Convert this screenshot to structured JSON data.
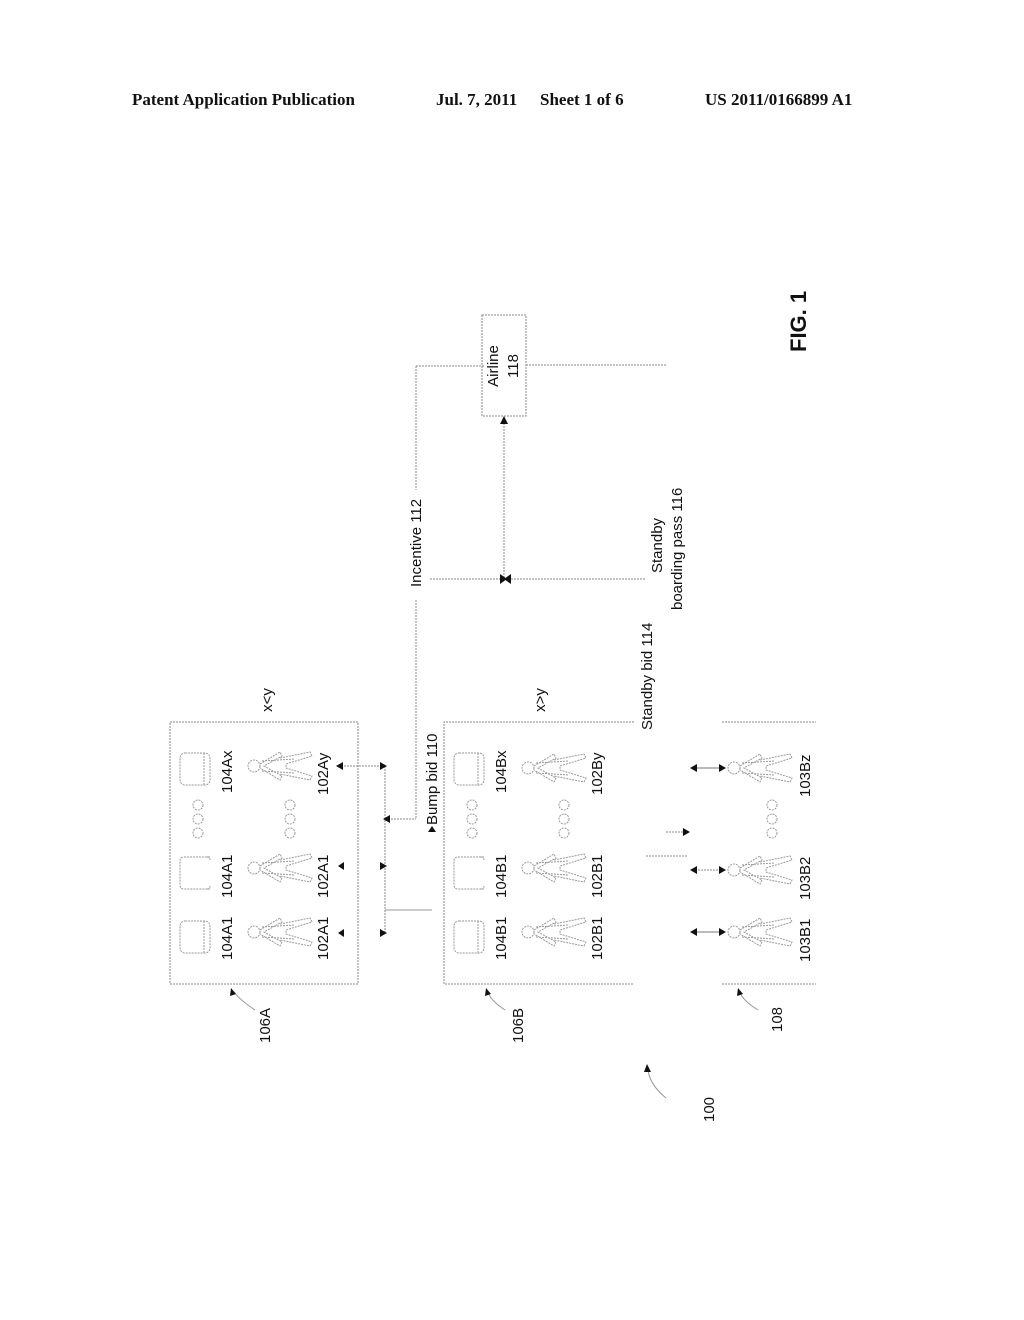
{
  "header": {
    "publication": "Patent Application Publication",
    "date": "Jul. 7, 2011",
    "sheet": "Sheet 1 of 6",
    "number": "US 2011/0166899 A1"
  },
  "figure": {
    "label": "FIG. 1",
    "system_ref": "100",
    "groups": [
      {
        "ref": "106A",
        "condition": "x<y",
        "seats": [
          "104A1",
          "104A1",
          "104Ax"
        ],
        "passengers": [
          "102A1",
          "102A1",
          "102Ay"
        ]
      },
      {
        "ref": "106B",
        "condition": "x>y",
        "seats": [
          "104B1",
          "104B1",
          "104Bx"
        ],
        "passengers": [
          "102B1",
          "102B1",
          "102By"
        ]
      },
      {
        "ref": "108",
        "passengers": [
          "103B1",
          "103B2",
          "103Bz"
        ]
      }
    ],
    "airline": {
      "name": "Airline",
      "ref": "118"
    },
    "signals": {
      "bump_bid": "Bump bid 110",
      "incentive": "Incentive 112",
      "standby_bid": "Standby bid 114",
      "standby_pass_line1": "Standby",
      "standby_pass_line2": "boarding pass 116"
    }
  }
}
